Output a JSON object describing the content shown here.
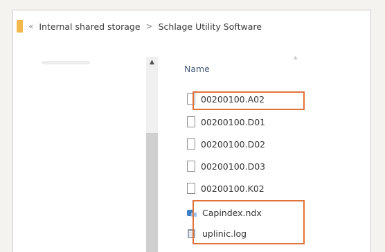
{
  "breadcrumb": {
    "back_symbol": "«",
    "root": "Internal shared storage",
    "separator": ">",
    "folder": "Schlage Utility Software"
  },
  "file_list": {
    "column_header": "Name",
    "files": [
      {
        "name": "00200100.A02",
        "icon": "file-icon"
      },
      {
        "name": "00200100.D01",
        "icon": "file-icon"
      },
      {
        "name": "00200100.D02",
        "icon": "file-icon"
      },
      {
        "name": "00200100.D03",
        "icon": "file-icon"
      },
      {
        "name": "00200100.K02",
        "icon": "file-icon"
      },
      {
        "name": "Capindex.ndx",
        "icon": "index-file-icon"
      },
      {
        "name": "uplinic.log",
        "icon": "log-file-icon"
      }
    ]
  },
  "colors": {
    "highlight": "#e0733a",
    "folder": "#f2b84b",
    "header_text": "#4a5d7a"
  }
}
